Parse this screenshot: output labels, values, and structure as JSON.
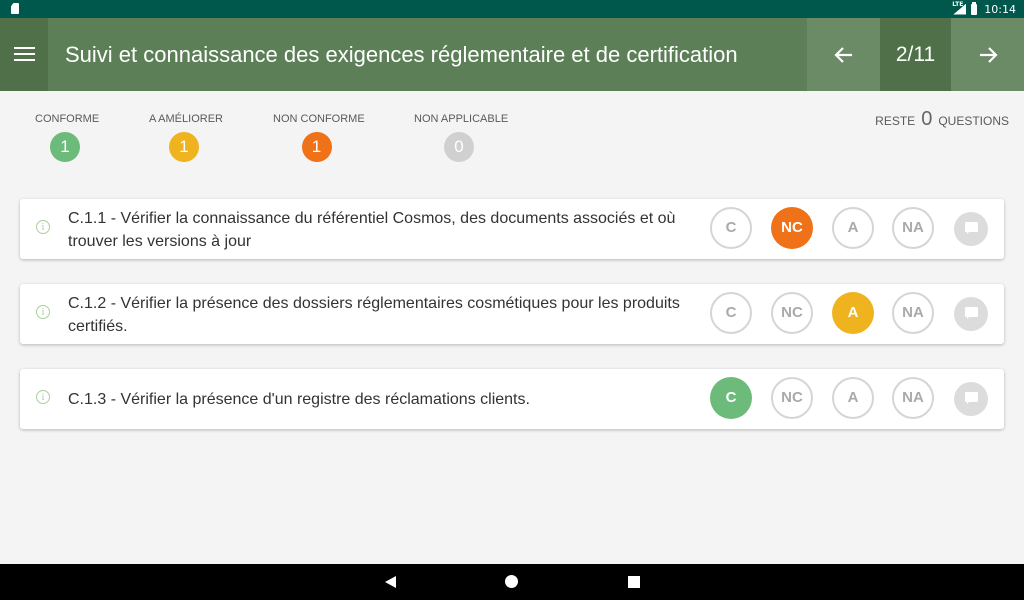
{
  "status_bar": {
    "time": "10:14",
    "signal_label": "LTE"
  },
  "header": {
    "title": "Suivi et connaissance des exigences réglementaire et de certification",
    "page_indicator": "2/11",
    "prev_icon": "arrow-left-icon",
    "next_icon": "arrow-right-icon",
    "menu_icon": "hamburger-menu-icon",
    "colors": {
      "bar": "#5d7f58",
      "dark": "#4f7049",
      "nav": "#6b8a66"
    }
  },
  "summary": {
    "items": [
      {
        "label": "CONFORME",
        "count": "1",
        "color": "#6dbb7a"
      },
      {
        "label": "A AMÉLIORER",
        "count": "1",
        "color": "#efb31f"
      },
      {
        "label": "NON CONFORME",
        "count": "1",
        "color": "#ef7118"
      },
      {
        "label": "NON APPLICABLE",
        "count": "0",
        "color": "#d0d0d0"
      }
    ],
    "remaining_prefix": "RESTE",
    "remaining_count": "0",
    "remaining_suffix": "QUESTIONS"
  },
  "options": {
    "c": "C",
    "nc": "NC",
    "a": "A",
    "na": "NA"
  },
  "questions": [
    {
      "text": "C.1.1 - Vérifier la connaissance du référentiel Cosmos, des documents associés et où trouver les versions à jour",
      "selected": "NC"
    },
    {
      "text": "C.1.2 - Vérifier la présence des dossiers réglementaires cosmétiques pour les produits certifiés.",
      "selected": "A"
    },
    {
      "text": "C.1.3 - Vérifier la présence d'un registre des réclamations clients.",
      "selected": "C"
    }
  ],
  "info_glyph": "i"
}
